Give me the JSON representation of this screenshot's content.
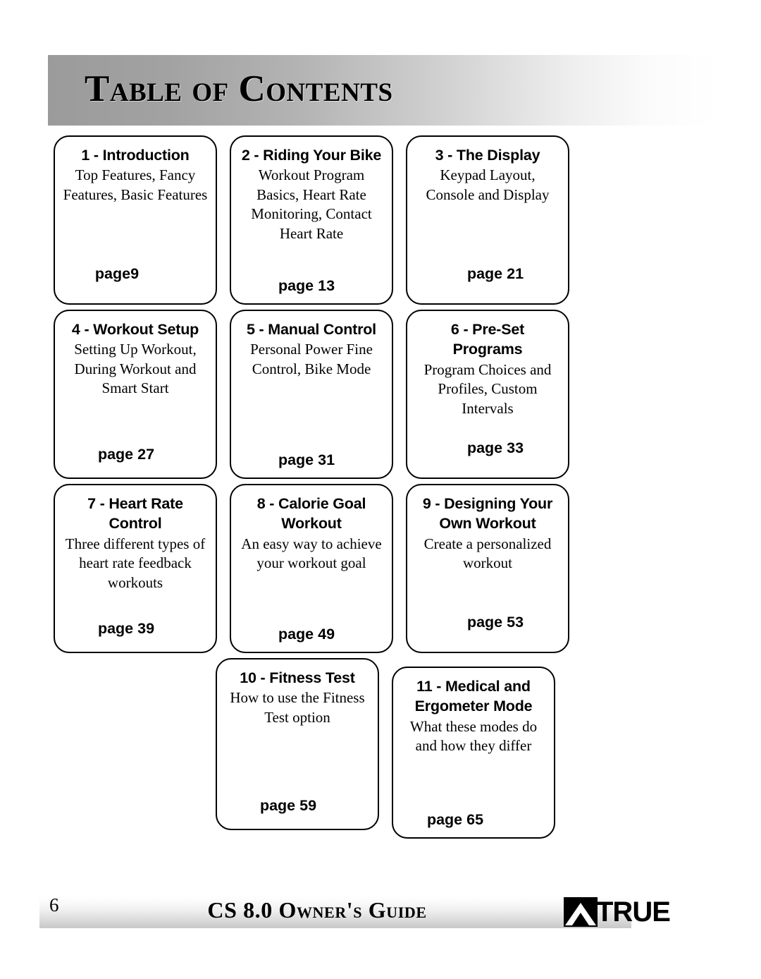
{
  "header": {
    "title": "Table of Contents"
  },
  "cards": [
    {
      "title": "1 - Introduction",
      "desc": "Top Features, Fancy Features, Basic Features",
      "page": "page9"
    },
    {
      "title": "2 - Riding Your Bike",
      "desc": "Workout Program Basics, Heart Rate Monitoring, Contact Heart Rate",
      "page": "page 13"
    },
    {
      "title": "3 - The Display",
      "desc": "Keypad Layout, Console and Display",
      "page": "page 21"
    },
    {
      "title": "4 - Workout Setup",
      "desc": "Setting Up Workout, During Workout and Smart Start",
      "page": "page 27"
    },
    {
      "title": "5 - Manual Control",
      "desc": "Personal Power Fine Control, Bike Mode",
      "page": "page 31"
    },
    {
      "title": "6 - Pre-Set Programs",
      "desc": "Program Choices and Profiles, Custom Intervals",
      "page": "page 33"
    },
    {
      "title": "7 - Heart Rate Control",
      "desc": "Three different types of heart rate feedback workouts",
      "page": "page 39"
    },
    {
      "title": "8 - Calorie Goal Workout",
      "desc": "An easy way to achieve your workout goal",
      "page": "page 49"
    },
    {
      "title": "9 - Designing Your Own Workout",
      "desc": "Create a personalized workout",
      "page": "page 53"
    },
    {
      "title": "10 - Fitness Test",
      "desc": "How to use the Fitness Test option",
      "page": "page 59"
    },
    {
      "title": "11 - Medical and Ergometer Mode",
      "desc": "What these modes do and how they differ",
      "page": "page 65"
    }
  ],
  "footer": {
    "page_number": "6",
    "guide_title": "CS 8.0 Owner's Guide",
    "brand": "TRUE"
  }
}
